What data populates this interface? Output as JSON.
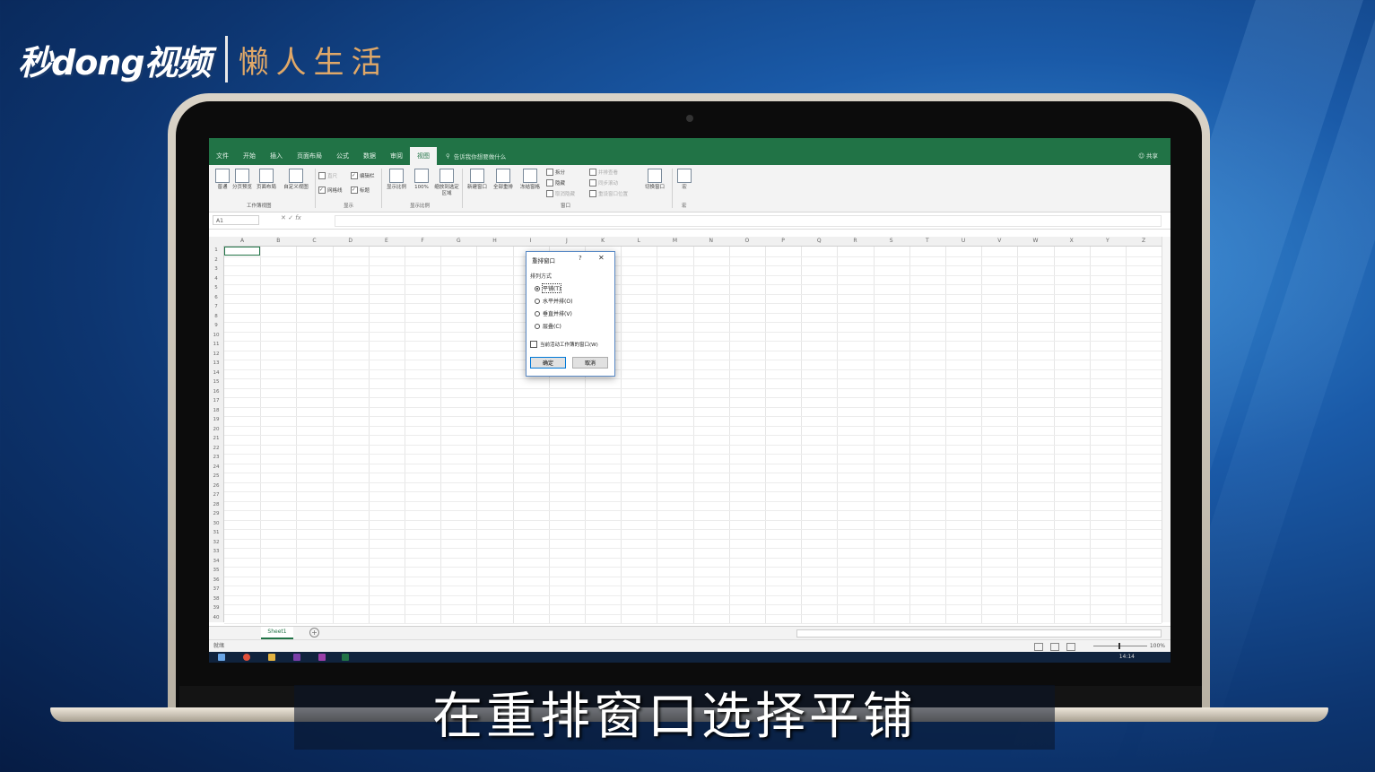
{
  "brand": {
    "main": "秒dong视频",
    "sub": "懒人生活"
  },
  "excel": {
    "tabs": [
      "文件",
      "开始",
      "插入",
      "页面布局",
      "公式",
      "数据",
      "审阅",
      "视图"
    ],
    "active_tab": "视图",
    "tell_me": "告诉我你想要做什么",
    "share": "共享",
    "ribbon": {
      "workbook_views": [
        "普通",
        "分页预览",
        "页面布局",
        "自定义视图"
      ],
      "show": {
        "ruler": "直尺",
        "formula_bar": "编辑栏",
        "gridlines": "网格线",
        "headings": "标题"
      },
      "zoom": [
        "显示比例",
        "100%",
        "缩放到选定区域"
      ],
      "window": [
        "新建窗口",
        "全部重排",
        "冻结窗格"
      ],
      "window_small": [
        "拆分",
        "隐藏",
        "取消隐藏"
      ],
      "window_side": [
        "并排查看",
        "同步滚动",
        "重设窗口位置"
      ],
      "switch_window": "切换窗口",
      "macros": "宏",
      "groups": [
        "工作簿视图",
        "显示",
        "显示比例",
        "窗口",
        "宏"
      ]
    },
    "name_box": "A1",
    "fx": "fx",
    "columns": [
      "A",
      "B",
      "C",
      "D",
      "E",
      "F",
      "G",
      "H",
      "I",
      "J",
      "K",
      "L",
      "M",
      "N",
      "O",
      "P",
      "Q",
      "R",
      "S",
      "T",
      "U",
      "V",
      "W",
      "X",
      "Y",
      "Z"
    ],
    "rows": [
      "1",
      "2",
      "3",
      "4",
      "5",
      "6",
      "7",
      "8",
      "9",
      "10",
      "11",
      "12",
      "13",
      "14",
      "15",
      "16",
      "17",
      "18",
      "19",
      "20",
      "21",
      "22",
      "23",
      "24",
      "25",
      "26",
      "27",
      "28",
      "29",
      "30",
      "31",
      "32",
      "33",
      "34",
      "35",
      "36",
      "37",
      "38",
      "39",
      "40"
    ],
    "sheet_tab": "Sheet1",
    "status": "就绪",
    "zoom_level": "100%",
    "clock": "14:14"
  },
  "dialog": {
    "title": "重排窗口",
    "help": "?",
    "close": "✕",
    "group_label": "排列方式",
    "options": [
      "平铺(T)",
      "水平并排(O)",
      "垂直并排(V)",
      "层叠(C)"
    ],
    "selected": "平铺(T)",
    "checkbox": "当前活动工作簿的窗口(W)",
    "ok": "确定",
    "cancel": "取消"
  },
  "subtitle": "在重排窗口选择平铺"
}
